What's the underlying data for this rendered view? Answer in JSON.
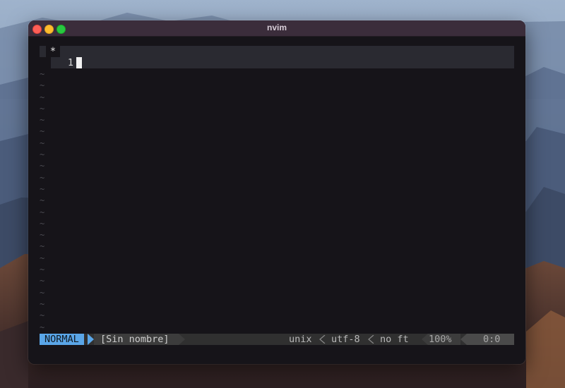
{
  "window": {
    "title": "nvim"
  },
  "editor": {
    "tab_marker": "*",
    "line_number": "1",
    "tilde": "~"
  },
  "statusline": {
    "mode": "NORMAL",
    "buffer_name": "[Sin nombre]",
    "fileformat": "unix",
    "encoding": "utf-8",
    "filetype": "no ft",
    "percent": "100%",
    "position": "0:0"
  },
  "colors": {
    "mode_bg": "#5aa6e8",
    "titlebar_bg": "#3b2d3b",
    "editor_bg": "#161419",
    "close": "#fe5f57",
    "minimize": "#febc2e",
    "zoom": "#28c840"
  }
}
